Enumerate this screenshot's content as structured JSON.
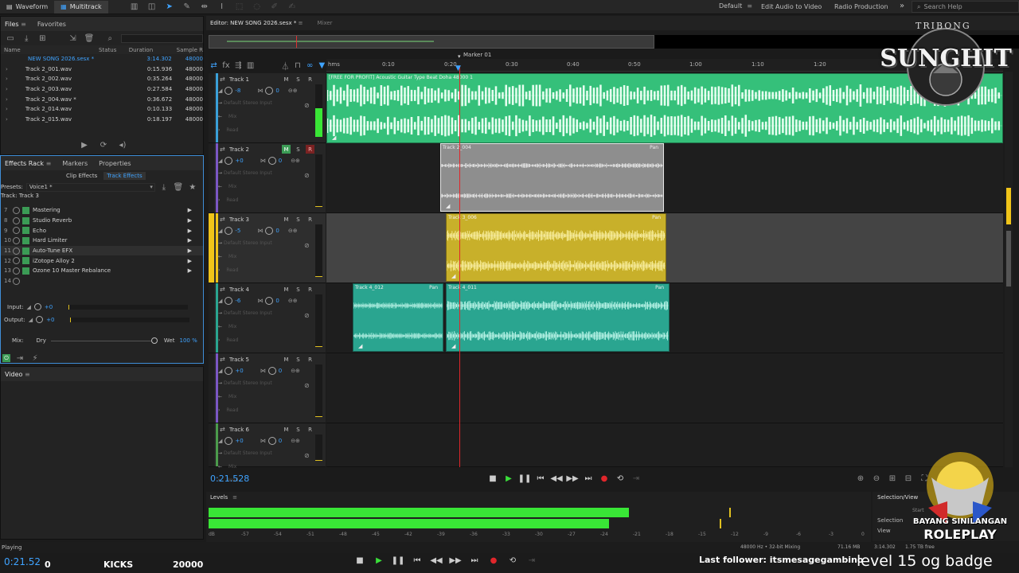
{
  "topbar": {
    "modes": [
      {
        "label": "Waveform",
        "active": false
      },
      {
        "label": "Multitrack",
        "active": true
      }
    ],
    "workspaces": [
      {
        "label": "Default",
        "active": true
      },
      {
        "label": "Edit Audio to Video",
        "active": false
      },
      {
        "label": "Radio Production",
        "active": false
      }
    ],
    "overflow": "»",
    "search_placeholder": "Search Help"
  },
  "files_panel": {
    "tabs": [
      "Files",
      "Favorites"
    ],
    "columns": [
      "Name",
      "Status",
      "Duration",
      "Sample R"
    ],
    "rows": [
      {
        "name": "NEW SONG 2026.sesx *",
        "status": "",
        "duration": "3:14.302",
        "rate": "48000",
        "highlight": true
      },
      {
        "name": "Track 2_001.wav",
        "status": "",
        "duration": "0:15.936",
        "rate": "48000"
      },
      {
        "name": "Track 2_002.wav",
        "status": "",
        "duration": "0:35.264",
        "rate": "48000"
      },
      {
        "name": "Track 2_003.wav",
        "status": "",
        "duration": "0:27.584",
        "rate": "48000"
      },
      {
        "name": "Track 2_004.wav *",
        "status": "",
        "duration": "0:36.672",
        "rate": "48000"
      },
      {
        "name": "Track 2_014.wav",
        "status": "",
        "duration": "0:10.133",
        "rate": "48000"
      },
      {
        "name": "Track 2_015.wav",
        "status": "",
        "duration": "0:18.197",
        "rate": "48000"
      }
    ]
  },
  "effects_panel": {
    "tabs": [
      "Effects Rack",
      "Markers",
      "Properties"
    ],
    "subtabs": [
      "Clip Effects",
      "Track Effects"
    ],
    "presets_label": "Presets:",
    "preset_value": "Voice1 *",
    "track_label": "Track: Track 3",
    "effects": [
      {
        "num": "7",
        "name": "Mastering"
      },
      {
        "num": "8",
        "name": "Studio Reverb"
      },
      {
        "num": "9",
        "name": "Echo"
      },
      {
        "num": "10",
        "name": "Hard Limiter"
      },
      {
        "num": "11",
        "name": "Auto-Tune EFX"
      },
      {
        "num": "12",
        "name": "iZotope Alloy 2"
      },
      {
        "num": "13",
        "name": "Ozone 10 Master Rebalance"
      },
      {
        "num": "14",
        "name": ""
      }
    ],
    "input_label": "Input:",
    "input_value": "+0",
    "output_label": "Output:",
    "output_value": "+0",
    "mix_label": "Mix:",
    "dry_label": "Dry",
    "wet_label": "Wet",
    "wet_value": "100 %"
  },
  "video_panel": {
    "title": "Video"
  },
  "editor": {
    "tabs": [
      {
        "label": "Editor: NEW SONG 2026.sesx *",
        "active": true
      },
      {
        "label": "Mixer",
        "active": false
      }
    ],
    "marker_label": "Marker 01",
    "ruler_ticks": [
      "hms",
      "0:10",
      "0:20",
      "0:30",
      "0:40",
      "0:50",
      "1:00",
      "1:10",
      "1:20"
    ],
    "tracks": [
      {
        "name": "Track 1",
        "vol": "-8",
        "pan": "0",
        "input": "Default Stereo Input",
        "mix": "Mix",
        "read": "Read"
      },
      {
        "name": "Track 2",
        "vol": "+0",
        "pan": "0",
        "input": "Default Stereo Input",
        "mix": "Mix",
        "read": "Read"
      },
      {
        "name": "Track 3",
        "vol": "-5",
        "pan": "0",
        "input": "Default Stereo Input",
        "mix": "Mix",
        "read": "Read"
      },
      {
        "name": "Track 4",
        "vol": "-6",
        "pan": "0",
        "input": "Default Stereo Input",
        "mix": "Mix",
        "read": "Read"
      },
      {
        "name": "Track 5",
        "vol": "+0",
        "pan": "0",
        "input": "Default Stereo Input",
        "mix": "Mix",
        "read": "Read"
      },
      {
        "name": "Track 6",
        "vol": "+0",
        "pan": "0",
        "input": "Default Stereo Input",
        "mix": "Mix",
        "read": "Read"
      }
    ],
    "clips": [
      {
        "title": "[FREE FOR PROFIT] Acoustic Guitar Type Beat Doha 48000 1",
        "pan": ""
      },
      {
        "title": "Track 2_004",
        "pan": "Pan"
      },
      {
        "title": "Track 3_006",
        "pan": "Pan"
      },
      {
        "title": "Track 4_012",
        "pan": "Pan"
      },
      {
        "title": "Track 4_011",
        "pan": "Pan"
      }
    ],
    "msr": [
      "M",
      "S",
      "R"
    ],
    "playhead_time": "0:21.528"
  },
  "levels": {
    "title": "Levels",
    "scale": [
      "dB",
      "-57",
      "-54",
      "-51",
      "-48",
      "-45",
      "-42",
      "-39",
      "-36",
      "-33",
      "-30",
      "-27",
      "-24",
      "-21",
      "-18",
      "-15",
      "-12",
      "-9",
      "-6",
      "-3",
      "0"
    ],
    "left_fill": 0.64,
    "right_fill": 0.61
  },
  "selection_view": {
    "title": "Selection/View",
    "start_label": "Start",
    "selection_label": "Selection",
    "view_label": "View"
  },
  "statusbar": {
    "state": "Playing",
    "format": "48000 Hz • 32-bit Mixing",
    "size": "71.16 MB",
    "duration": "3:14.302",
    "free": "1.75 TB free"
  },
  "overlay": {
    "time": "0:21.52",
    "count": "0",
    "kicks_label": "KICKS",
    "kicks_value": "20000",
    "follower": "Last follower: itsmesagegambino",
    "badge": "level 15 og badge"
  },
  "logos": {
    "top_right": [
      "TRIBONG",
      "SUNGHIT"
    ],
    "bottom_right": [
      "BAYANG SINILANGAN",
      "ROLEPLAY"
    ]
  },
  "colors": {
    "accent": "#3fa3ff",
    "track1": "#35c07a",
    "track2": "#8e8e8e",
    "track3": "#c8b02a",
    "track4": "#2aa590",
    "meter": "#39e636",
    "record": "#e0262b",
    "selected_track_bar": "#f0c419"
  }
}
